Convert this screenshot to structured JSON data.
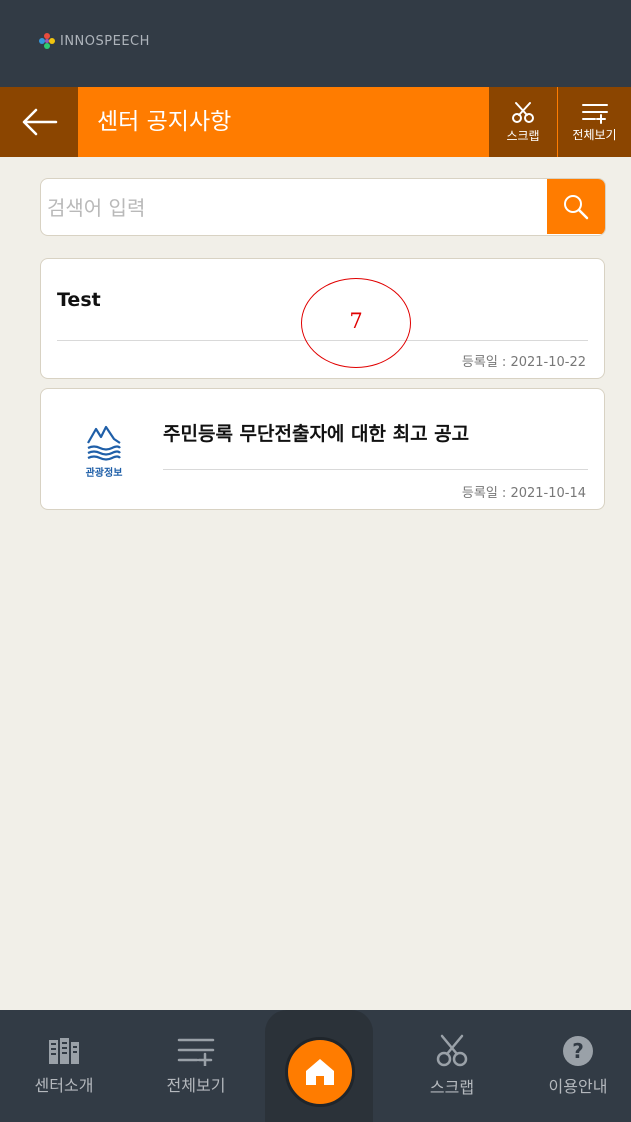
{
  "header": {
    "brand": "INNOSPEECH"
  },
  "titlebar": {
    "title": "센터 공지사항",
    "actions": {
      "scrap_label": "스크랩",
      "view_all_label": "전체보기"
    }
  },
  "search": {
    "placeholder": "검색어 입력",
    "value": ""
  },
  "notices": [
    {
      "title": "Test",
      "date": "등록일 : 2021-10-22"
    },
    {
      "title": "주민등록 무단전출자에 대한 최고 공고",
      "date": "등록일 : 2021-10-14",
      "thumbnail_label": "관광정보"
    }
  ],
  "annotation": {
    "label": "7"
  },
  "bottom_nav": {
    "center_intro": "센터소개",
    "view_all": "전체보기",
    "scrap": "스크랩",
    "guide": "이용안내"
  },
  "colors": {
    "accent": "#ff7c00",
    "accent_dark": "#8b4500",
    "bar_dark": "#323b45",
    "background": "#f1efe8",
    "annotation": "#e00000"
  }
}
